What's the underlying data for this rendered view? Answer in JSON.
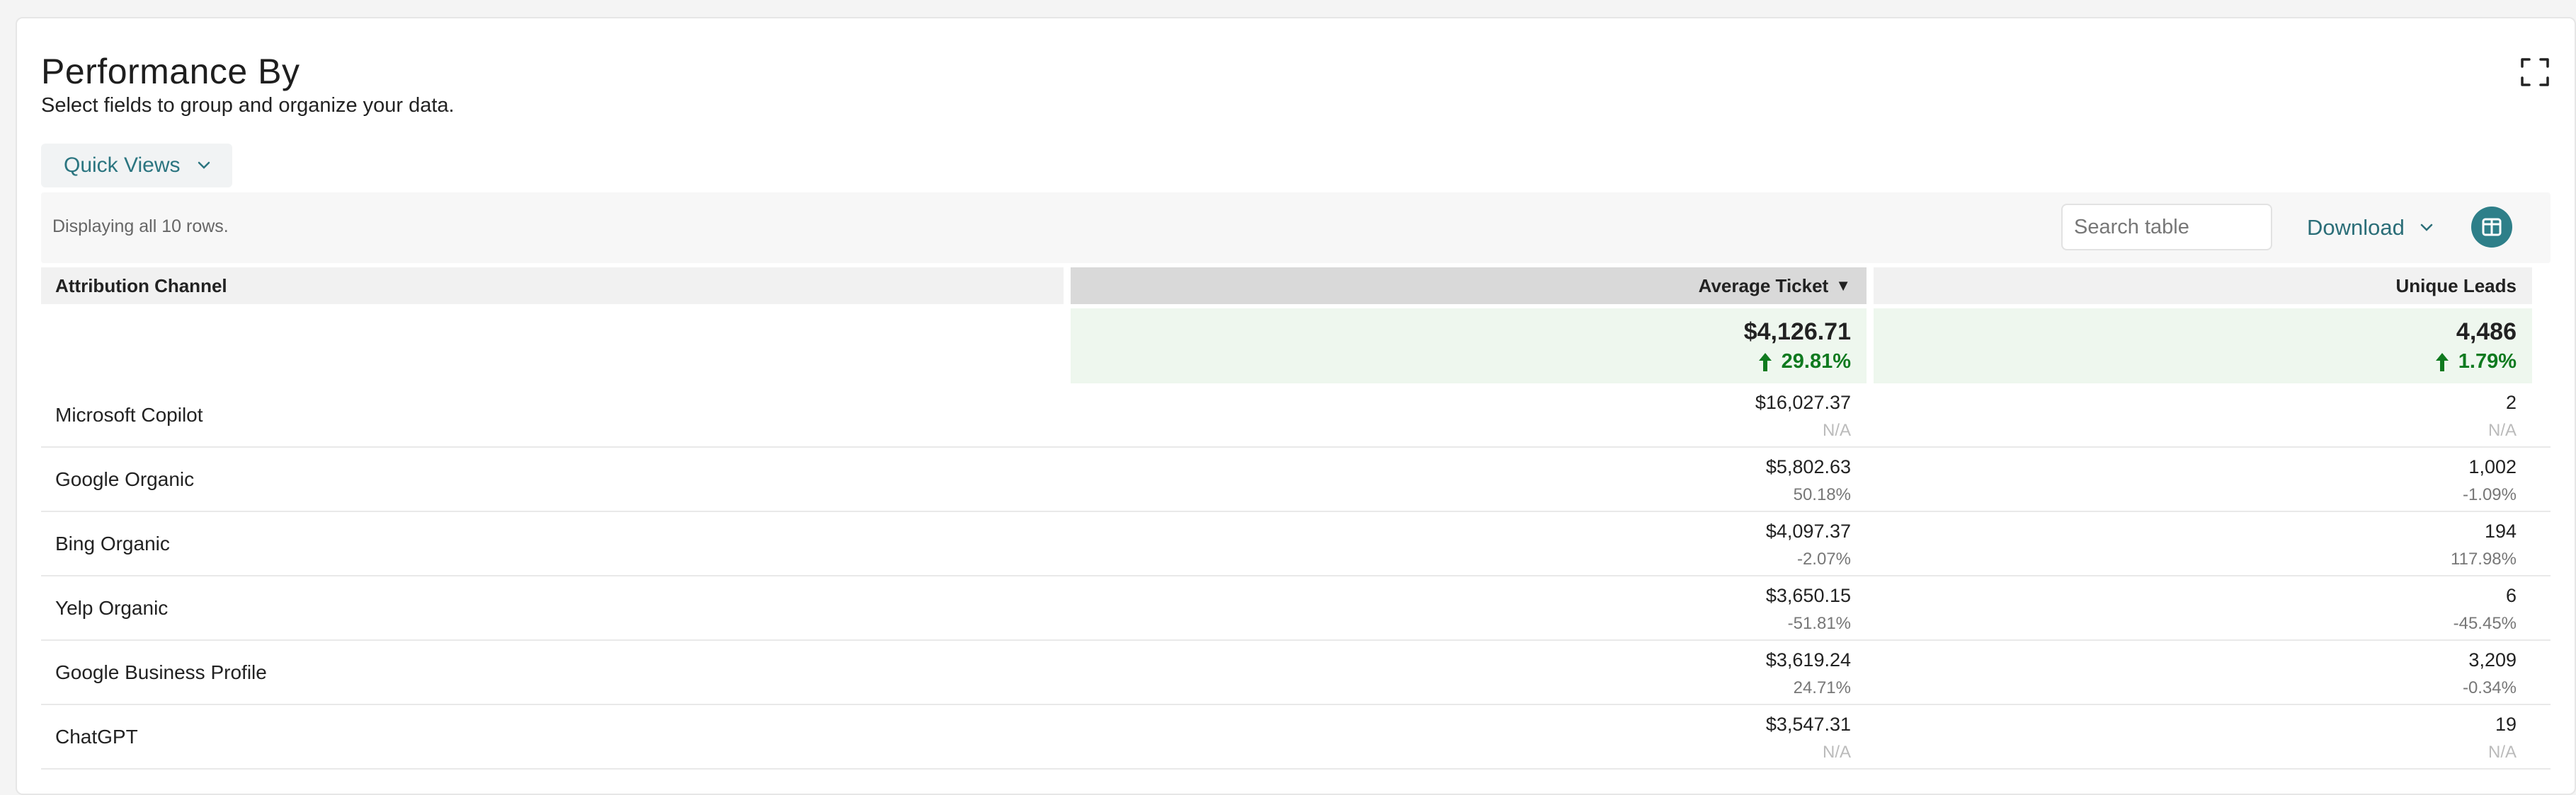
{
  "header": {
    "title": "Performance By",
    "subtitle": "Select fields to group and organize your data."
  },
  "quick_views": {
    "label": "Quick Views"
  },
  "toolbar": {
    "row_count_text": "Displaying all 10 rows.",
    "search_placeholder": "Search table",
    "download_label": "Download"
  },
  "table": {
    "columns": [
      "Attribution Channel",
      "Average Ticket",
      "Unique Leads"
    ],
    "sorted_column_indicator": "▼",
    "totals": {
      "avg_ticket": "$4,126.71",
      "avg_ticket_change": "29.81%",
      "unique_leads": "4,486",
      "unique_leads_change": "1.79%"
    },
    "rows": [
      {
        "channel": "Microsoft Copilot",
        "avg_ticket": "$16,027.37",
        "avg_ticket_change": "N/A",
        "unique_leads": "2",
        "unique_leads_change": "N/A"
      },
      {
        "channel": "Google Organic",
        "avg_ticket": "$5,802.63",
        "avg_ticket_change": "50.18%",
        "unique_leads": "1,002",
        "unique_leads_change": "-1.09%"
      },
      {
        "channel": "Bing Organic",
        "avg_ticket": "$4,097.37",
        "avg_ticket_change": "-2.07%",
        "unique_leads": "194",
        "unique_leads_change": "117.98%"
      },
      {
        "channel": "Yelp Organic",
        "avg_ticket": "$3,650.15",
        "avg_ticket_change": "-51.81%",
        "unique_leads": "6",
        "unique_leads_change": "-45.45%"
      },
      {
        "channel": "Google Business Profile",
        "avg_ticket": "$3,619.24",
        "avg_ticket_change": "24.71%",
        "unique_leads": "3,209",
        "unique_leads_change": "-0.34%"
      },
      {
        "channel": "ChatGPT",
        "avg_ticket": "$3,547.31",
        "avg_ticket_change": "N/A",
        "unique_leads": "19",
        "unique_leads_change": "N/A"
      }
    ]
  },
  "colors": {
    "accent": "#2e7f89",
    "positive": "#0f7a1f",
    "totals_bg": "#eef7ee",
    "sorted_header_bg": "#d9d9d9"
  },
  "icons": {
    "expand": "expand-icon",
    "chevron": "chevron-down-icon",
    "columns": "columns-icon",
    "trend_up": "arrow-up-icon"
  }
}
